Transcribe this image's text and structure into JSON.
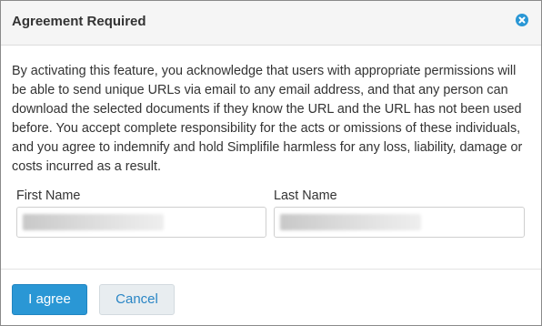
{
  "dialog": {
    "title": "Agreement Required",
    "close_icon": "close-circle-icon",
    "message": "By activating this feature, you acknowledge that users with appropriate permissions will be able to send unique URLs via email to any email address, and that any person can download the selected documents if they know the URL and the URL has not been used before. You accept complete responsibility for the acts or omissions of these individuals, and you agree to indemnify and hold Simplifile harmless for any loss, liability, damage or costs incurred as a result.",
    "fields": {
      "first_name": {
        "label": "First Name",
        "value": ""
      },
      "last_name": {
        "label": "Last Name",
        "value": ""
      }
    },
    "buttons": {
      "agree": "I agree",
      "cancel": "Cancel"
    }
  },
  "colors": {
    "primary": "#2a97d5",
    "close_icon": "#2a97d5",
    "cancel_text": "#2a86c5",
    "cancel_bg": "#e8edf0",
    "header_bg": "#f5f5f5"
  }
}
